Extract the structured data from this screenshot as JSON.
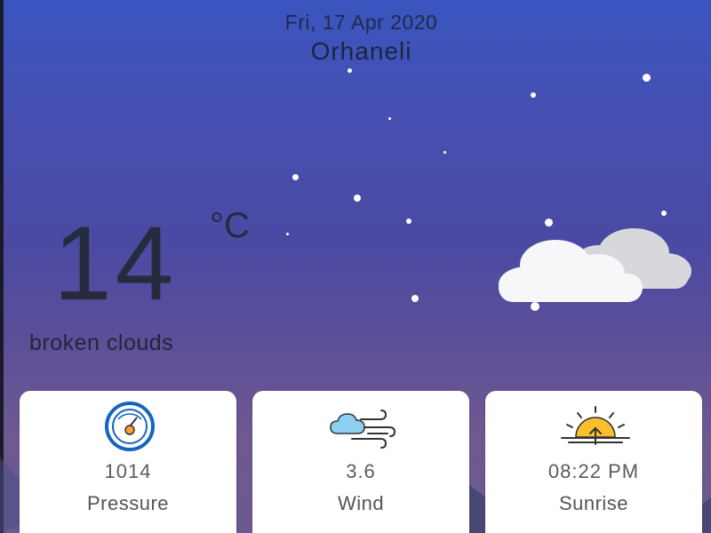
{
  "header": {
    "date": "Fri, 17 Apr 2020",
    "city": "Orhaneli"
  },
  "current": {
    "temperature": "14",
    "unit": "°C",
    "description": "broken clouds",
    "weather_icon": "broken-clouds-icon"
  },
  "cards": [
    {
      "value": "1014",
      "label": "Pressure",
      "icon": "pressure-gauge-icon"
    },
    {
      "value": "3.6",
      "label": "Wind",
      "icon": "wind-icon"
    },
    {
      "value": "08:22 PM",
      "label": "Sunrise",
      "icon": "sunrise-icon"
    }
  ],
  "colors": {
    "sky_top": "#3a55bf",
    "sky_bottom": "#6a5a8f",
    "text_dark": "#262b3e",
    "gauge_blue": "#1565c0",
    "sun_yellow": "#f9c02b"
  }
}
